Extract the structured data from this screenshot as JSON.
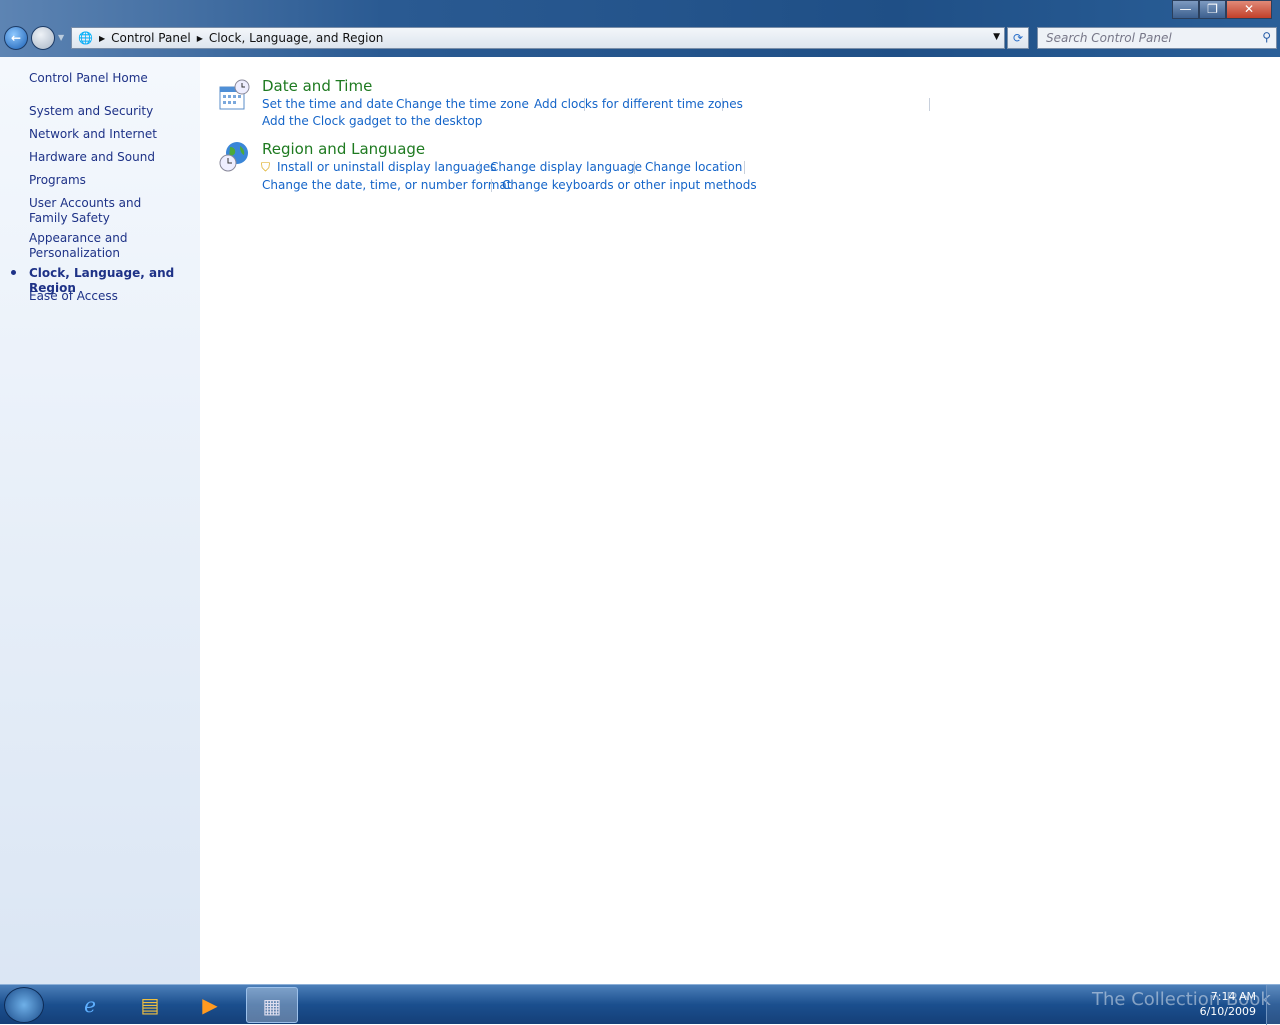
{
  "window": {
    "minimize": "—",
    "restore": "❐",
    "close": "✕"
  },
  "address": {
    "crumbs": [
      "Control Panel",
      "Clock, Language, and Region"
    ],
    "search_placeholder": "Search Control Panel"
  },
  "sidebar": {
    "home": "Control Panel Home",
    "items": [
      "System and Security",
      "Network and Internet",
      "Hardware and Sound",
      "Programs",
      "User Accounts and Family Safety",
      "Appearance and Personalization",
      "Clock, Language, and Region",
      "Ease of Access"
    ],
    "active": "Clock, Language, and Region"
  },
  "categories": [
    {
      "title": "Date and Time",
      "links": [
        "Set the time and date",
        "Change the time zone",
        "Add clocks for different time zones",
        "Add the Clock gadget to the desktop"
      ]
    },
    {
      "title": "Region and Language",
      "links": [
        "Install or uninstall display languages",
        "Change display language",
        "Change location",
        "Change the date, time, or number format",
        "Change keyboards or other input methods"
      ]
    }
  ],
  "taskbar": {
    "time": "7:14 AM",
    "date": "6/10/2009",
    "watermark": "The Collection Book"
  }
}
